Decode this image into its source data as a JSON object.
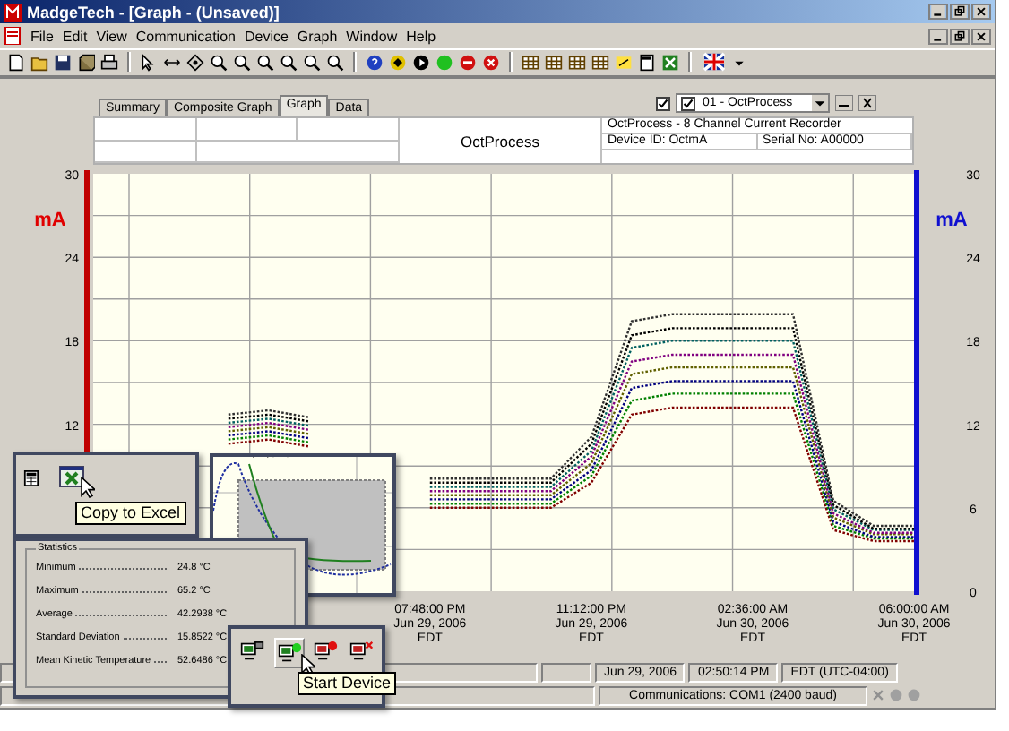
{
  "window": {
    "title": "MadgeTech - [Graph - (Unsaved)]"
  },
  "menu": [
    "File",
    "Edit",
    "View",
    "Communication",
    "Device",
    "Graph",
    "Window",
    "Help"
  ],
  "tabs": [
    {
      "label": "Summary",
      "selected": false
    },
    {
      "label": "Composite Graph",
      "selected": false
    },
    {
      "label": "Graph",
      "selected": true
    },
    {
      "label": "Data",
      "selected": false
    }
  ],
  "channel_selector": {
    "checked": true,
    "item_checked": true,
    "value": "01 - OctProcess"
  },
  "graph_header": {
    "title": "OctProcess",
    "description": "OctProcess - 8 Channel Current Recorder",
    "device_id": "Device ID: OctmA",
    "serial": "Serial No: A00000"
  },
  "chart_data": {
    "type": "line",
    "grid": true,
    "ylabel": "mA",
    "y2label": "mA",
    "ylim": [
      0,
      30
    ],
    "y2lim": [
      0,
      30
    ],
    "yticks": [
      12,
      18,
      24,
      30
    ],
    "y2ticks": [
      0,
      6,
      12,
      18,
      24,
      30
    ],
    "categories": [
      null,
      null,
      null,
      null,
      null,
      null,
      null,
      null,
      "07:48:00 PM\nJun 29, 2006\nEDT",
      null,
      null,
      null,
      "11:12:00 PM\nJun 29, 2006\nEDT",
      null,
      null,
      null,
      "02:36:00 AM\nJun 30, 2006\nEDT",
      null,
      null,
      null,
      "06:00:00 AM\nJun 30, 2006\nEDT"
    ],
    "series": [
      {
        "color": "#800000",
        "line_style": "dotted",
        "values": [
          null,
          null,
          null,
          10.6,
          10.9,
          10.4,
          null,
          null,
          6.0,
          6.0,
          6.0,
          6.0,
          7.8,
          12.7,
          13.2,
          13.2,
          13.2,
          13.2,
          4.4,
          3.6,
          3.6
        ]
      },
      {
        "color": "#008000",
        "line_style": "dotted",
        "values": [
          null,
          null,
          null,
          10.9,
          11.2,
          10.7,
          null,
          null,
          6.3,
          6.3,
          6.3,
          6.3,
          8.3,
          13.7,
          14.2,
          14.2,
          14.2,
          14.2,
          4.7,
          3.8,
          3.8
        ]
      },
      {
        "color": "#000080",
        "line_style": "dotted",
        "values": [
          null,
          null,
          null,
          11.2,
          11.5,
          11.0,
          null,
          null,
          6.6,
          6.6,
          6.6,
          6.6,
          8.7,
          14.6,
          15.1,
          15.1,
          15.1,
          15.1,
          5.0,
          3.9,
          3.9
        ]
      },
      {
        "color": "#606000",
        "line_style": "dotted",
        "values": [
          null,
          null,
          null,
          11.5,
          11.8,
          11.3,
          null,
          null,
          6.9,
          6.9,
          6.9,
          6.9,
          9.2,
          15.6,
          16.1,
          16.1,
          16.1,
          16.1,
          5.3,
          4.1,
          4.1
        ]
      },
      {
        "color": "#800080",
        "line_style": "dotted",
        "values": [
          null,
          null,
          null,
          11.8,
          12.1,
          11.6,
          null,
          null,
          7.2,
          7.2,
          7.2,
          7.2,
          9.7,
          16.5,
          17.0,
          17.0,
          17.0,
          17.0,
          5.6,
          4.2,
          4.2
        ]
      },
      {
        "color": "#006060",
        "line_style": "dotted",
        "values": [
          null,
          null,
          null,
          12.1,
          12.4,
          11.9,
          null,
          null,
          7.5,
          7.5,
          7.5,
          7.5,
          10.1,
          17.5,
          18.0,
          18.0,
          18.0,
          18.0,
          5.9,
          4.4,
          4.4
        ]
      },
      {
        "color": "#000000",
        "line_style": "dotted",
        "values": [
          null,
          null,
          null,
          12.4,
          12.7,
          12.2,
          null,
          null,
          7.8,
          7.8,
          7.8,
          7.8,
          10.6,
          18.4,
          18.9,
          18.9,
          18.9,
          18.9,
          6.2,
          4.5,
          4.5
        ]
      },
      {
        "color": "#303030",
        "line_style": "dotted",
        "values": [
          null,
          null,
          null,
          12.7,
          13.0,
          12.5,
          null,
          null,
          8.1,
          8.1,
          8.1,
          8.1,
          11.1,
          19.4,
          19.9,
          19.9,
          19.9,
          19.9,
          6.5,
          4.7,
          4.7
        ]
      }
    ]
  },
  "excel_toolbar": {
    "tooltip": "Copy to Excel"
  },
  "statistics": {
    "title": "Statistics",
    "rows": [
      {
        "label": "Minimum",
        "value": "24.8 °C"
      },
      {
        "label": "Maximum",
        "value": "65.2 °C"
      },
      {
        "label": "Average",
        "value": "42.2938 °C"
      },
      {
        "label": "Standard Deviation",
        "value": "15.8522 °C"
      },
      {
        "label": "Mean Kinetic Temperature",
        "value": "52.6486 °C"
      }
    ]
  },
  "device_toolbar": {
    "tooltip": "Start Device"
  },
  "status_bar": {
    "date": "Jun 29, 2006",
    "time": "02:50:14 PM",
    "zone": "EDT (UTC-04:00)",
    "communications": "Communications: COM1 (2400 baud)"
  }
}
